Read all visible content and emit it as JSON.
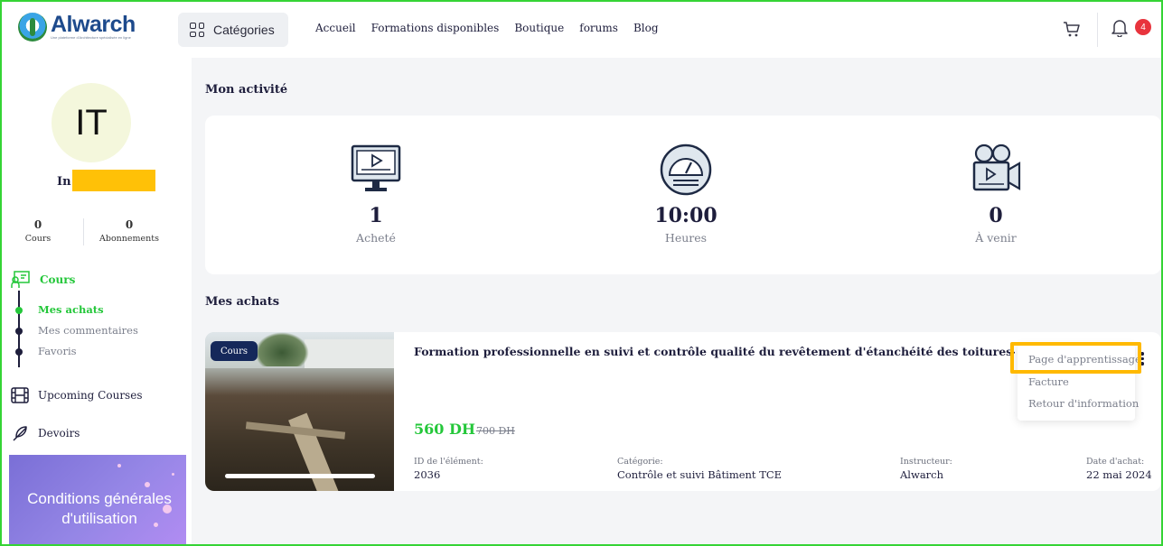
{
  "header": {
    "brand": "Alwarch",
    "tagline": "Une plateforme d'Architecture spécialisée en ligne",
    "categories_label": "Catégories",
    "nav": [
      "Accueil",
      "Formations disponibles",
      "Boutique",
      "forums",
      "Blog"
    ],
    "notifications_count": "4"
  },
  "profile": {
    "initials": "IT",
    "name_visible": "In",
    "stats": [
      {
        "value": "0",
        "label": "Cours"
      },
      {
        "value": "0",
        "label": "Abonnements"
      }
    ]
  },
  "sidebar": {
    "cours_label": "Cours",
    "sub_items": [
      "Mes achats",
      "Mes commentaires",
      "Favoris"
    ],
    "upcoming_label": "Upcoming Courses",
    "devoirs_label": "Devoirs",
    "promo_text": "Conditions générales d'utilisation"
  },
  "activity": {
    "title": "Mon activité",
    "items": [
      {
        "value": "1",
        "caption": "Acheté",
        "icon": "monitor-play-icon"
      },
      {
        "value": "10:00",
        "caption": "Heures",
        "icon": "speedometer-icon"
      },
      {
        "value": "0",
        "caption": "À venir",
        "icon": "video-camera-icon"
      }
    ]
  },
  "purchases": {
    "title": "Mes achats",
    "course": {
      "badge": "Cours",
      "title": "Formation professionnelle en suivi et contrôle qualité du revêtement d'étanchéité des toitures-terrasses et parois",
      "price": "560 DH",
      "old_price": "700 DH",
      "meta": [
        {
          "label": "ID de l'élément:",
          "value": "2036"
        },
        {
          "label": "Catégorie:",
          "value": "Contrôle et suivi Bâtiment TCE"
        },
        {
          "label": "Instructeur:",
          "value": "Alwarch"
        },
        {
          "label": "Date d'achat:",
          "value": "22 mai 2024"
        }
      ]
    },
    "menu": [
      "Page d'apprentissage",
      "Facture",
      "Retour d'information"
    ]
  },
  "colors": {
    "accent_green": "#24c73a",
    "navy": "#15285a",
    "badge_red": "#e8343d",
    "highlight": "#ffb900"
  }
}
